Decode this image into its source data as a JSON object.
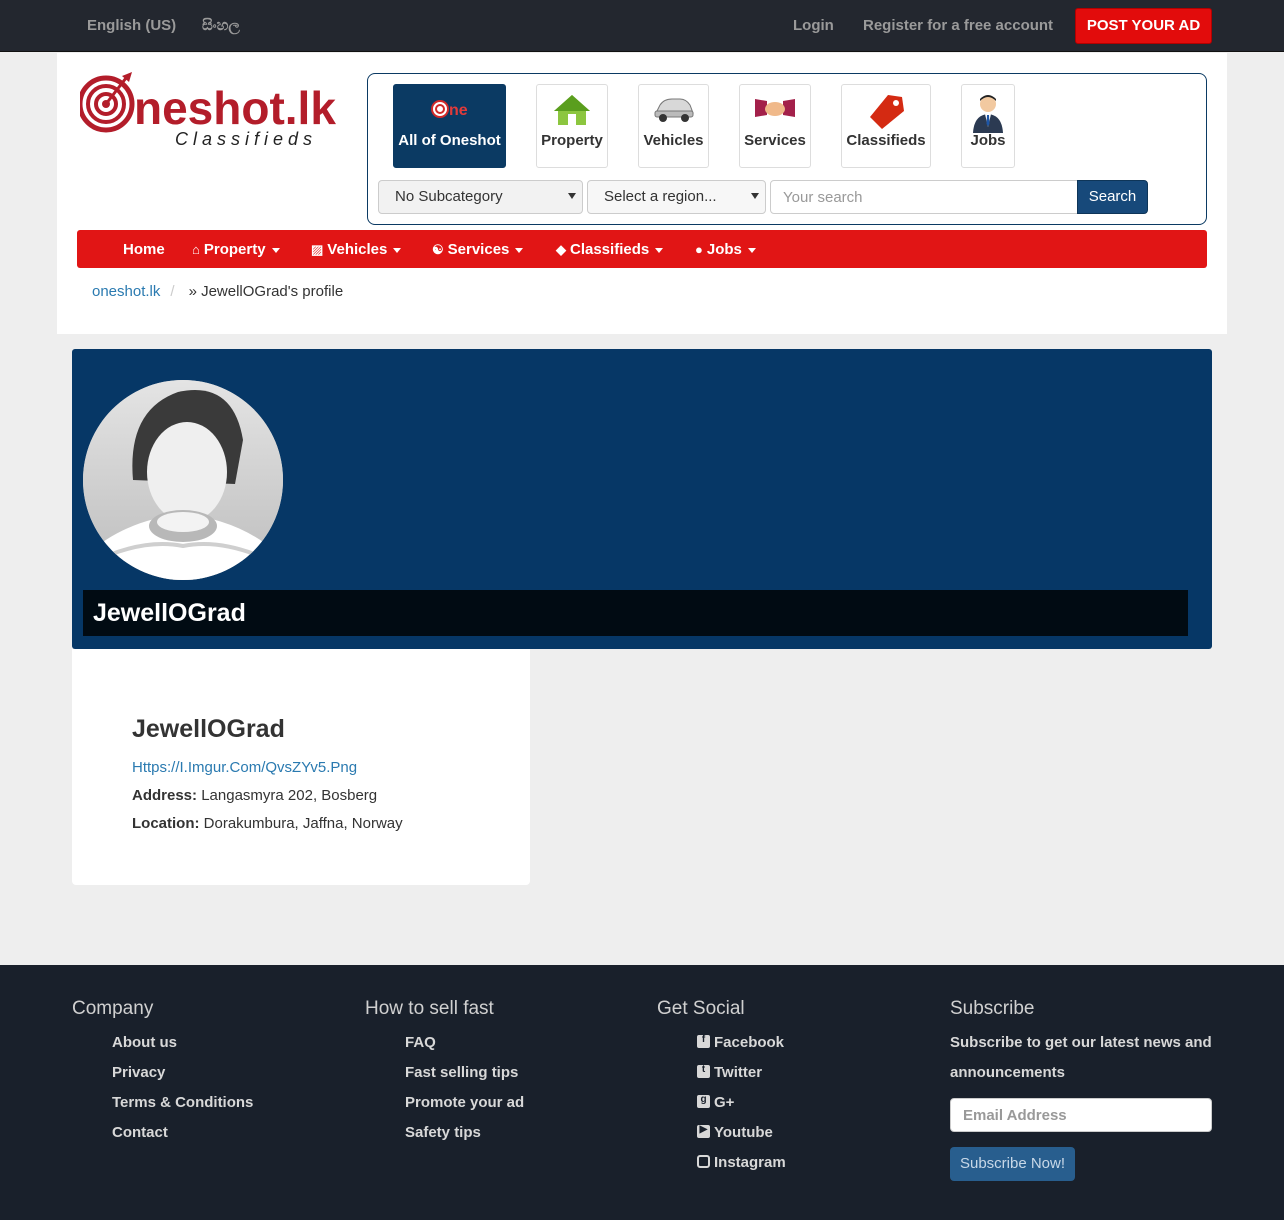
{
  "topbar": {
    "lang_en": "English (US)",
    "lang_si": "සිංහල",
    "login": "Login",
    "register": "Register for a free account",
    "post_ad": "POST YOUR AD"
  },
  "logo": {
    "brand": "neshot.lk",
    "tagline": "Classifieds"
  },
  "categories": [
    {
      "label": "All of Oneshot",
      "icon": "oneshot-logo-icon"
    },
    {
      "label": "Property",
      "icon": "house-icon"
    },
    {
      "label": "Vehicles",
      "icon": "car-icon"
    },
    {
      "label": "Services",
      "icon": "handshake-icon"
    },
    {
      "label": "Classifieds",
      "icon": "tag-icon"
    },
    {
      "label": "Jobs",
      "icon": "businessman-icon"
    }
  ],
  "search": {
    "subcategory": "No Subcategory",
    "region": "Select a region...",
    "placeholder": "Your search",
    "button": "Search"
  },
  "nav": {
    "home": "Home",
    "property": "Property",
    "vehicles": "Vehicles",
    "services": "Services",
    "classifieds": "Classifieds",
    "jobs": "Jobs"
  },
  "breadcrumb": {
    "home": "oneshot.lk",
    "current": "» JewellOGrad's profile"
  },
  "profile": {
    "name": "JewellOGrad",
    "link": "Https://I.Imgur.Com/QvsZYv5.Png",
    "address_label": "Address:",
    "address": "Langasmyra 202, Bosberg",
    "location_label": "Location:",
    "location": "Dorakumbura, Jaffna, Norway"
  },
  "footer": {
    "company_title": "Company",
    "company_links": [
      "About us",
      "Privacy",
      "Terms & Conditions",
      "Contact"
    ],
    "sell_title": "How to sell fast",
    "sell_links": [
      "FAQ",
      "Fast selling tips",
      "Promote your ad",
      "Safety tips"
    ],
    "social_title": "Get Social",
    "social_links": [
      "Facebook",
      "Twitter",
      "G+",
      "Youtube",
      "Instagram"
    ],
    "subscribe_title": "Subscribe",
    "subscribe_text": "Subscribe to get our latest news and announcements",
    "email_placeholder": "Email Address",
    "subscribe_button": "Subscribe Now!"
  },
  "colors": {
    "brand_red": "#e11515",
    "brand_navy": "#063766",
    "topbar": "#23272f",
    "footer": "#19202b"
  }
}
